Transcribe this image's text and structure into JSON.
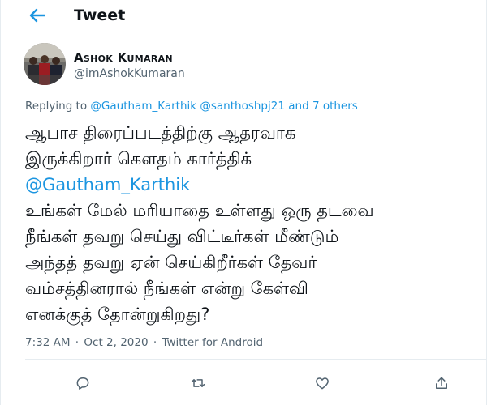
{
  "header": {
    "title": "Tweet",
    "back_icon": "arrow-left-icon"
  },
  "author": {
    "name": "Ashok Kumaran",
    "handle": "@imAshokKumaran"
  },
  "replying": {
    "prefix": "Replying to",
    "mention1": "@Gautham_Karthik",
    "mention2": "@santhoshpj21",
    "conjunction": "and",
    "others": "7 others"
  },
  "tweet": {
    "lines": [
      "ஆபாச திரைப்படத்திற்கு ஆதரவாக",
      "இருக்கிறார் கௌதம் கார்த்திக்",
      "@Gautham_Karthik",
      "உங்கள் மேல் மரியாதை உள்ளது ஒரு தடவை",
      "நீங்கள் தவறு செய்து விட்டீர்கள் மீண்டும்",
      "அந்தத் தவறு ஏன் செய்கிறீர்கள் தேவர்",
      "வம்சத்தினரால் நீங்கள் என்று கேள்வி",
      "எனக்குத் தோன்றுகிறது?"
    ],
    "mention_line_index": 2
  },
  "meta": {
    "time": "7:32 AM",
    "separator": "·",
    "date": "Oct 2, 2020",
    "source": "Twitter for Android"
  },
  "actions": {
    "reply_icon": "reply-icon",
    "retweet_icon": "retweet-icon",
    "like_icon": "heart-icon",
    "share_icon": "share-icon"
  },
  "colors": {
    "link": "#1b95e0",
    "secondary_text": "#536471",
    "primary_text": "#0f1419",
    "divider": "#e6ecf0"
  }
}
